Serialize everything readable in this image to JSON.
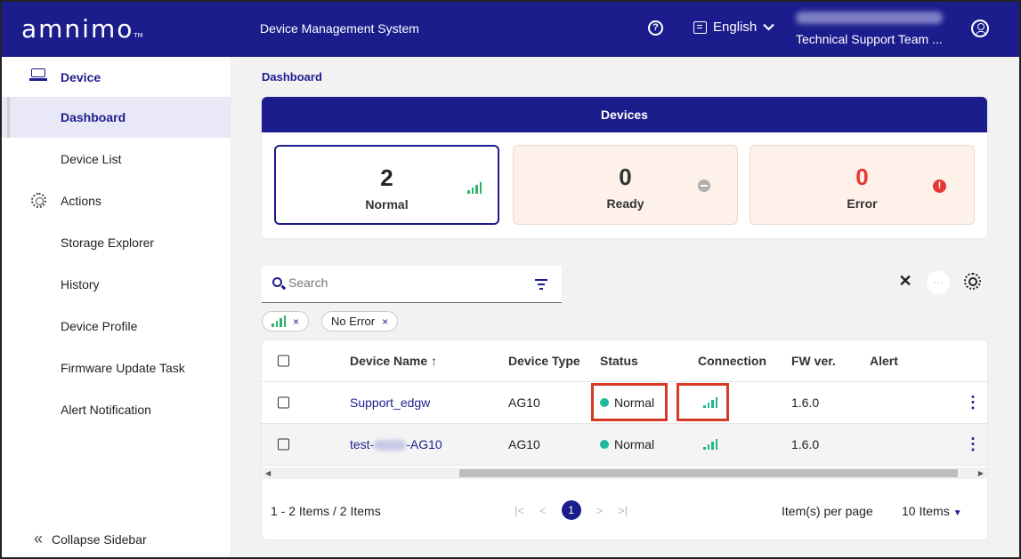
{
  "header": {
    "logo": "amnimo",
    "logo_tm": "TM",
    "system_title": "Device Management System",
    "help_icon": "?",
    "language": "English",
    "team": "Technical Support Team ..."
  },
  "sidebar": {
    "items": [
      {
        "label": "Device"
      },
      {
        "label": "Dashboard"
      },
      {
        "label": "Device List"
      },
      {
        "label": "Actions"
      },
      {
        "label": "Storage Explorer"
      },
      {
        "label": "History"
      },
      {
        "label": "Device Profile"
      },
      {
        "label": "Firmware Update Task"
      },
      {
        "label": "Alert Notification"
      }
    ],
    "collapse_label": "Collapse Sidebar",
    "collapse_icon": "«"
  },
  "main": {
    "breadcrumb": "Dashboard",
    "devices_title": "Devices",
    "cards": {
      "normal": {
        "count": "2",
        "label": "Normal"
      },
      "ready": {
        "count": "0",
        "label": "Ready"
      },
      "error": {
        "count": "0",
        "label": "Error",
        "icon": "!"
      }
    },
    "search_placeholder": "Search",
    "filters": {
      "signal_x": "×",
      "no_error": "No Error",
      "no_error_x": "×"
    },
    "table": {
      "headers": {
        "name": "Device Name ↑",
        "type": "Device Type",
        "status": "Status",
        "connection": "Connection",
        "fw": "FW ver.",
        "alert": "Alert"
      },
      "rows": [
        {
          "name": "Support_edgw",
          "type": "AG10",
          "status": "Normal",
          "fw": "1.6.0",
          "alert": ""
        },
        {
          "name": "test-",
          "name_suffix": "-AG10",
          "type": "AG10",
          "status": "Normal",
          "fw": "1.6.0",
          "alert": ""
        }
      ],
      "kebab": "⋮",
      "scroll_left": "◀",
      "scroll_right": "▶"
    },
    "footer": {
      "count_text": "1 - 2 Items / 2 Items",
      "first": "|<",
      "prev": "<",
      "page": "1",
      "next": ">",
      "last": ">|",
      "per_page_label": "Item(s) per page",
      "per_page_value": "10 Items",
      "per_page_caret": "▼"
    },
    "toolbar": {
      "tools_icon": "✕",
      "more_icon": "···"
    }
  },
  "colors": {
    "brand": "#1c1d8d",
    "normal_green": "#2db36b",
    "error_red": "#e53935",
    "highlight": "#d63a23"
  },
  "icons": [
    "question-icon",
    "chat-icon",
    "chevron-down-icon",
    "user-icon",
    "device-icon",
    "actions-icon",
    "signal-icon",
    "minus-circle-icon",
    "error-icon",
    "search-icon",
    "filter-icon",
    "tools-icon",
    "more-icon",
    "settings-icon",
    "kebab-icon"
  ]
}
